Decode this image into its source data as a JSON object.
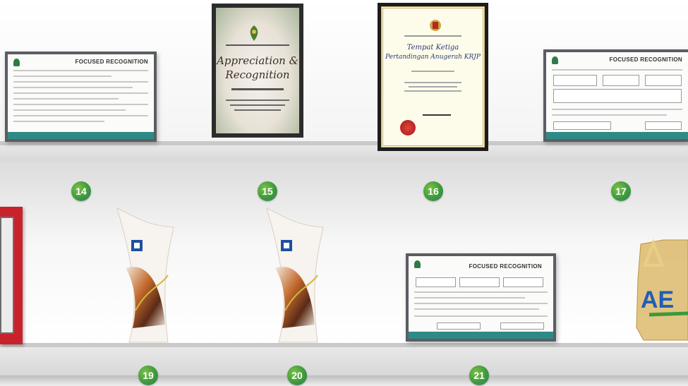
{
  "shelf_numbers": {
    "n14": "14",
    "n15": "15",
    "n16": "16",
    "n17": "17",
    "n19": "19",
    "n20": "20",
    "n21": "21"
  },
  "items": {
    "cert14_title": "FOCUSED RECOGNITION",
    "plaque15_line1": "Appreciation &",
    "plaque15_line2": "Recognition",
    "cert16_line1": "Tempat Ketiga",
    "cert16_line2": "Pertandingan Anugerah KRJP",
    "cert17_title": "FOCUSED RECOGNITION",
    "cert21_title": "FOCUSED RECOGNITION",
    "acrylic_text": "AE"
  },
  "colors": {
    "badge_green": "#3e9a3a",
    "footer_teal": "#2e8a86",
    "trophy_blue": "#1f4ea3",
    "red_plaque": "#c8222b",
    "acrylic_gold": "#d9b25a"
  }
}
